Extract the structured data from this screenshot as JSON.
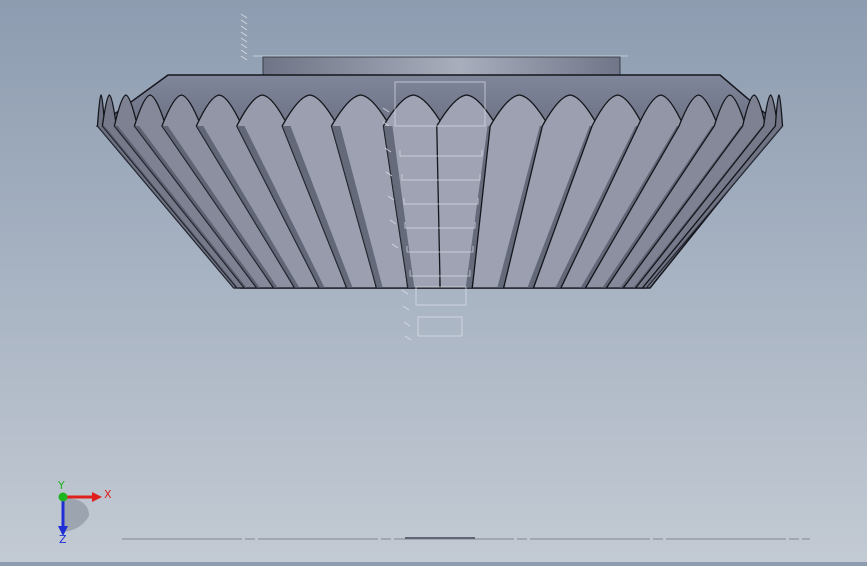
{
  "viewport": {
    "model": "bevel-gear",
    "view": "front",
    "tooth_count_visible": 20
  },
  "triad": {
    "x_label": "X",
    "y_label": "Y",
    "z_label": "Z",
    "x_color": "#e0201c",
    "y_color": "#1fb51f",
    "z_color": "#1f2fd6"
  },
  "colors": {
    "background_top": "#8d9cb0",
    "background_bottom": "#c3cad3",
    "gear_face": "#8e94a6",
    "gear_dark": "#5a5f70",
    "edge": "#1a1c24"
  }
}
